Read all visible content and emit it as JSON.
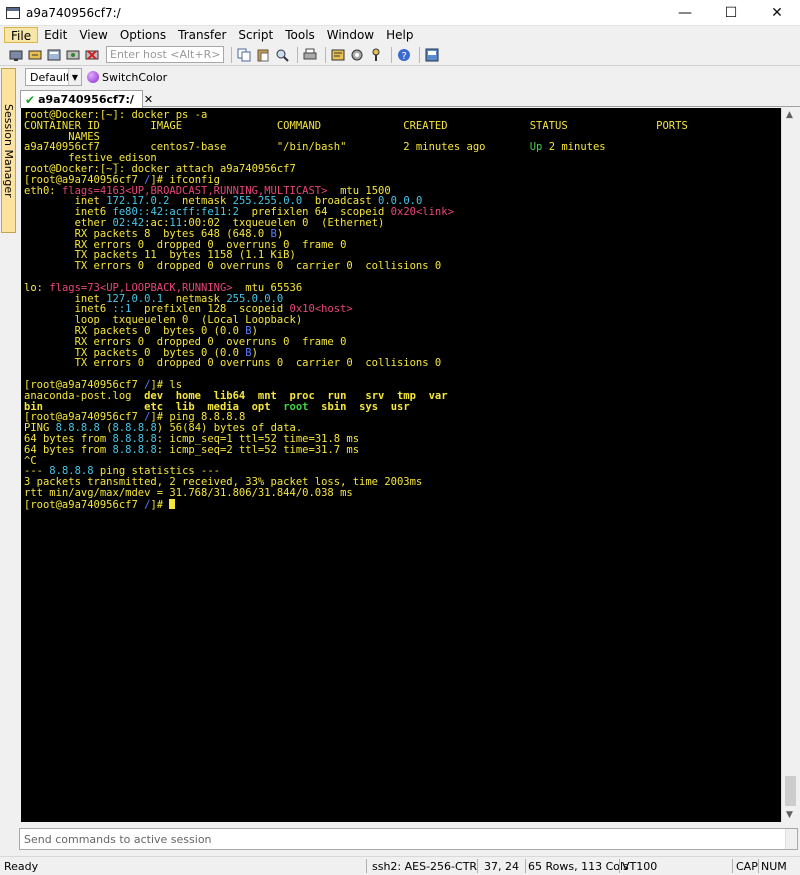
{
  "window": {
    "title": "a9a740956cf7:/"
  },
  "menu": [
    "File",
    "Edit",
    "View",
    "Options",
    "Transfer",
    "Script",
    "Tools",
    "Window",
    "Help"
  ],
  "toolbar": {
    "host_placeholder": "Enter host <Alt+R>"
  },
  "buttonbar": {
    "default_label": "Default",
    "switch_label": "SwitchColor"
  },
  "session_manager": {
    "label": "Session Manager"
  },
  "tab": {
    "label": "a9a740956cf7:/"
  },
  "terminal_lines": [
    [
      [
        "root@Docker:[~]: ",
        "y"
      ],
      [
        "docker ps -a",
        "y"
      ]
    ],
    [
      [
        "CONTAINER ID        IMAGE               COMMAND             CREATED             STATUS              PORTS",
        "y"
      ]
    ],
    [
      [
        "       NAMES",
        "y"
      ]
    ],
    [
      [
        "a9a740956cf7        centos7-base        \"/bin/bash\"         2 minutes ago       ",
        "y"
      ],
      [
        "Up",
        "g"
      ],
      [
        " 2 minutes",
        "y"
      ]
    ],
    [
      [
        "       festive_edison",
        "y"
      ]
    ],
    [
      [
        "root@Docker:[~]: docker attach a9a740956cf7",
        "y"
      ]
    ],
    [
      [
        "[root@a9a740956cf7 ",
        "y"
      ],
      [
        "/",
        "b"
      ],
      [
        "]# ifconfig",
        "y"
      ]
    ],
    [
      [
        "eth0: ",
        "y"
      ],
      [
        "flags=4163<UP,BROADCAST,RUNNING,MULTICAST>",
        "r"
      ],
      [
        "  mtu 1500",
        "y"
      ]
    ],
    [
      [
        "        inet ",
        "y"
      ],
      [
        "172.17.0.2",
        "c"
      ],
      [
        "  netmask ",
        "y"
      ],
      [
        "255.255.0.0",
        "c"
      ],
      [
        "  broadcast ",
        "y"
      ],
      [
        "0.0.0.0",
        "c"
      ]
    ],
    [
      [
        "        inet6 ",
        "y"
      ],
      [
        "fe80::42:acff:fe11:2",
        "c"
      ],
      [
        "  prefixlen 64  scopeid ",
        "y"
      ],
      [
        "0x20<link>",
        "r"
      ]
    ],
    [
      [
        "        ether ",
        "y"
      ],
      [
        "02:42",
        "c"
      ],
      [
        ":ac:",
        "y"
      ],
      [
        "11",
        "c"
      ],
      [
        ":00:02  txqueuelen 0  (Ethernet)",
        "y"
      ]
    ],
    [
      [
        "        RX packets 8  bytes 648 (648.0 ",
        "y"
      ],
      [
        "B",
        "b"
      ],
      [
        ")",
        "y"
      ]
    ],
    [
      [
        "        RX errors 0  dropped 0  overruns 0  frame 0",
        "y"
      ]
    ],
    [
      [
        "        TX packets 11  bytes 1158 (1.1 KiB)",
        "y"
      ]
    ],
    [
      [
        "        TX errors 0  dropped 0 overruns 0  carrier 0  collisions 0",
        "y"
      ]
    ],
    [
      [
        "",
        "y"
      ]
    ],
    [
      [
        "lo: ",
        "y"
      ],
      [
        "flags=73<UP,LOOPBACK,RUNNING>",
        "r"
      ],
      [
        "  mtu 65536",
        "y"
      ]
    ],
    [
      [
        "        inet ",
        "y"
      ],
      [
        "127.0.0.1",
        "c"
      ],
      [
        "  netmask ",
        "y"
      ],
      [
        "255.0.0.0",
        "c"
      ]
    ],
    [
      [
        "        inet6 ",
        "y"
      ],
      [
        "::1",
        "c"
      ],
      [
        "  prefixlen 128  scopeid ",
        "y"
      ],
      [
        "0x10<host>",
        "r"
      ]
    ],
    [
      [
        "        loop  txqueuelen 0  (Local Loopback)",
        "y"
      ]
    ],
    [
      [
        "        RX packets 0  bytes 0 (0.0 ",
        "y"
      ],
      [
        "B",
        "b"
      ],
      [
        ")",
        "y"
      ]
    ],
    [
      [
        "        RX errors 0  dropped 0  overruns 0  frame 0",
        "y"
      ]
    ],
    [
      [
        "        TX packets 0  bytes 0 (0.0 ",
        "y"
      ],
      [
        "B",
        "b"
      ],
      [
        ")",
        "y"
      ]
    ],
    [
      [
        "        TX errors 0  dropped 0 overruns 0  carrier 0  collisions 0",
        "y"
      ]
    ],
    [
      [
        "",
        "y"
      ]
    ],
    [
      [
        "[root@a9a740956cf7 ",
        "y"
      ],
      [
        "/",
        "b"
      ],
      [
        "]# ls",
        "y"
      ]
    ],
    [
      [
        "anaconda-post.log  ",
        "y"
      ],
      [
        "dev  home  lib64  mnt  proc  run",
        "yb"
      ],
      [
        "   ",
        "y"
      ],
      [
        "srv  tmp  var",
        "yb"
      ]
    ],
    [
      [
        "bin",
        "yb"
      ],
      [
        "                ",
        "y"
      ],
      [
        "etc  lib  media  opt  ",
        "yb"
      ],
      [
        "root",
        "gb"
      ],
      [
        "  ",
        "y"
      ],
      [
        "sbin  sys  usr",
        "yb"
      ]
    ],
    [
      [
        "[root@a9a740956cf7 ",
        "y"
      ],
      [
        "/",
        "b"
      ],
      [
        "]# ping 8.8.8.8",
        "y"
      ]
    ],
    [
      [
        "PING ",
        "y"
      ],
      [
        "8.8.8.8",
        "c"
      ],
      [
        " (",
        "y"
      ],
      [
        "8.8.8.8",
        "c"
      ],
      [
        ") 56(84) bytes of data.",
        "y"
      ]
    ],
    [
      [
        "64 bytes from ",
        "y"
      ],
      [
        "8.8.8.8",
        "c"
      ],
      [
        ": icmp_seq=1 ttl=52 time=31.8 ms",
        "y"
      ]
    ],
    [
      [
        "64 bytes from ",
        "y"
      ],
      [
        "8.8.8.8",
        "c"
      ],
      [
        ": icmp_seq=2 ttl=52 time=31.7 ms",
        "y"
      ]
    ],
    [
      [
        "^C",
        "y"
      ]
    ],
    [
      [
        "--- ",
        "y"
      ],
      [
        "8.8.8.8",
        "c"
      ],
      [
        " ping statistics ---",
        "y"
      ]
    ],
    [
      [
        "3 packets transmitted, 2 received, 33% packet loss, time 2003ms",
        "y"
      ]
    ],
    [
      [
        "rtt min/avg/max/mdev = 31.768/31.806/31.844/0.038 ms",
        "y"
      ]
    ],
    [
      [
        "[root@a9a740956cf7 ",
        "y"
      ],
      [
        "/",
        "b"
      ],
      [
        "]# ",
        "y"
      ]
    ]
  ],
  "command_window": {
    "placeholder": "Send commands to active session"
  },
  "status": {
    "ready": "Ready",
    "encryption": "ssh2: AES-256-CTR",
    "cursor_pos": "37,  24",
    "dims": "65 Rows, 113 Cols",
    "emulation": "VT100",
    "cap": "CAP",
    "num": "NUM"
  }
}
